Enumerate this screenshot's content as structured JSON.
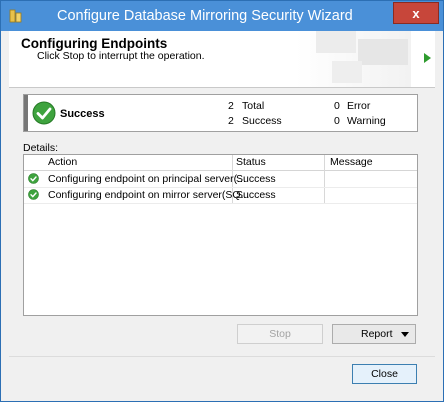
{
  "window": {
    "title": "Configure Database Mirroring Security Wizard",
    "close_glyph": "x"
  },
  "banner": {
    "title": "Configuring Endpoints",
    "subtitle": "Click Stop to interrupt the operation."
  },
  "summary": {
    "status": "Success",
    "total_count": "2",
    "total_label": "Total",
    "success_count": "2",
    "success_label": "Success",
    "error_count": "0",
    "error_label": "Error",
    "warning_count": "0",
    "warning_label": "Warning"
  },
  "details": {
    "label": "Details:",
    "columns": [
      "Action",
      "Status",
      "Message"
    ],
    "rows": [
      {
        "action": "Configuring endpoint on principal server(...",
        "status": "Success",
        "message": ""
      },
      {
        "action": "Configuring endpoint on mirror server(SQ...",
        "status": "Success",
        "message": ""
      }
    ]
  },
  "buttons": {
    "stop": "Stop",
    "report": "Report",
    "close": "Close"
  },
  "colors": {
    "title_bar": "#4a90d8",
    "success_green": "#3ea33e",
    "close_red": "#c7463a"
  },
  "icons": {
    "app": "database-wizard-icon",
    "success": "green-check-icon",
    "next": "green-arrow-icon"
  }
}
